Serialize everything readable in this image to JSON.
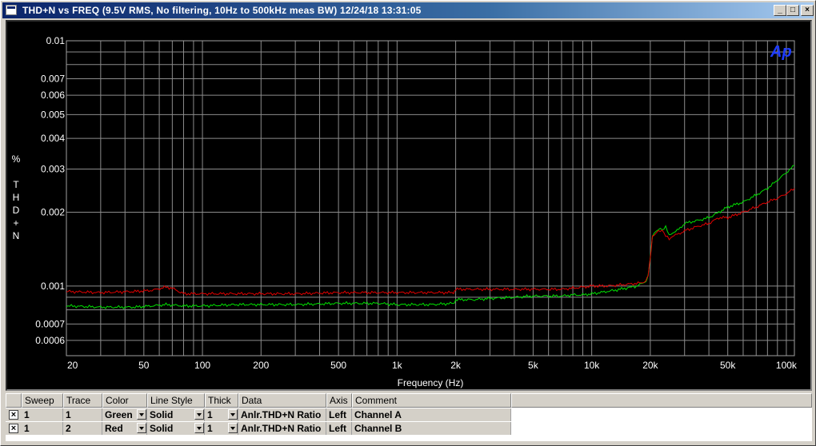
{
  "window": {
    "title": "THD+N vs FREQ (9.5V RMS, No filtering, 10Hz to 500kHz meas BW)  12/24/18 13:31:05",
    "buttons": {
      "minimize": "_",
      "maximize": "□",
      "close": "×"
    }
  },
  "chart_data": {
    "type": "line",
    "xscale": "log",
    "yscale": "log",
    "xlim": [
      20,
      110000
    ],
    "ylim": [
      0.00052,
      0.01
    ],
    "grid": true,
    "xlabel": "Frequency (Hz)",
    "ylabel_lines": [
      "%",
      "",
      "T",
      "H",
      "D",
      "+",
      "N"
    ],
    "x_ticks": [
      {
        "v": 20,
        "label": "20"
      },
      {
        "v": 50,
        "label": "50"
      },
      {
        "v": 100,
        "label": "100"
      },
      {
        "v": 200,
        "label": "200"
      },
      {
        "v": 500,
        "label": "500"
      },
      {
        "v": 1000,
        "label": "1k"
      },
      {
        "v": 2000,
        "label": "2k"
      },
      {
        "v": 5000,
        "label": "5k"
      },
      {
        "v": 10000,
        "label": "10k"
      },
      {
        "v": 20000,
        "label": "20k"
      },
      {
        "v": 50000,
        "label": "50k"
      },
      {
        "v": 100000,
        "label": "100k"
      }
    ],
    "y_ticks": [
      {
        "v": 0.01,
        "label": "0.01"
      },
      {
        "v": 0.007,
        "label": "0.007"
      },
      {
        "v": 0.006,
        "label": "0.006"
      },
      {
        "v": 0.005,
        "label": "0.005"
      },
      {
        "v": 0.004,
        "label": "0.004"
      },
      {
        "v": 0.003,
        "label": "0.003"
      },
      {
        "v": 0.002,
        "label": "0.002"
      },
      {
        "v": 0.001,
        "label": "0.001"
      },
      {
        "v": 0.0007,
        "label": "0.0007"
      },
      {
        "v": 0.0006,
        "label": "0.0006"
      }
    ],
    "logo": "Ap",
    "series": [
      {
        "name": "Channel A",
        "color": "#00e000",
        "x": [
          20,
          30,
          45,
          55,
          65,
          80,
          100,
          150,
          200,
          300,
          500,
          800,
          1000,
          1500,
          1950,
          2000,
          2500,
          3000,
          4000,
          5000,
          6000,
          7000,
          8000,
          9000,
          10000,
          11000,
          12000,
          13000,
          14000,
          15000,
          16000,
          17000,
          18000,
          19000,
          19500,
          20000,
          20500,
          21000,
          22000,
          23000,
          24000,
          25000,
          26000,
          28000,
          30000,
          35000,
          40000,
          45000,
          50000,
          60000,
          70000,
          80000,
          90000,
          100000,
          110000
        ],
        "values": [
          0.00083,
          0.00082,
          0.00082,
          0.00083,
          0.00084,
          0.00083,
          0.00083,
          0.00084,
          0.00084,
          0.00084,
          0.00085,
          0.00085,
          0.00084,
          0.00084,
          0.00085,
          0.00088,
          0.00088,
          0.00089,
          0.0009,
          0.00091,
          0.00091,
          0.00091,
          0.00092,
          0.00092,
          0.00093,
          0.00094,
          0.00095,
          0.00096,
          0.00097,
          0.00098,
          0.00099,
          0.001,
          0.00102,
          0.00105,
          0.0011,
          0.0013,
          0.0016,
          0.00165,
          0.0017,
          0.0017,
          0.00175,
          0.0016,
          0.00165,
          0.0017,
          0.0018,
          0.00185,
          0.0019,
          0.002,
          0.0021,
          0.0022,
          0.00235,
          0.0025,
          0.0027,
          0.0029,
          0.0031
        ]
      },
      {
        "name": "Channel B",
        "color": "#e00000",
        "x": [
          20,
          30,
          45,
          55,
          65,
          70,
          80,
          100,
          150,
          200,
          300,
          500,
          800,
          1000,
          1500,
          1950,
          2000,
          2500,
          3000,
          4000,
          5000,
          6000,
          7000,
          8000,
          9000,
          10000,
          12000,
          14000,
          16000,
          18000,
          19000,
          19500,
          20000,
          20500,
          21000,
          22000,
          23000,
          24000,
          25000,
          26000,
          28000,
          30000,
          35000,
          40000,
          45000,
          50000,
          60000,
          70000,
          80000,
          90000,
          100000,
          110000
        ],
        "values": [
          0.00095,
          0.00094,
          0.00095,
          0.00096,
          0.00099,
          0.00098,
          0.00093,
          0.00093,
          0.00093,
          0.00093,
          0.00093,
          0.00094,
          0.00094,
          0.00094,
          0.00094,
          0.00094,
          0.00097,
          0.00097,
          0.00097,
          0.00097,
          0.00097,
          0.00097,
          0.00097,
          0.00098,
          0.00099,
          0.001,
          0.001,
          0.00101,
          0.00102,
          0.00103,
          0.00105,
          0.0011,
          0.0013,
          0.0016,
          0.00163,
          0.00166,
          0.0017,
          0.0016,
          0.00155,
          0.0016,
          0.00163,
          0.00168,
          0.00175,
          0.0018,
          0.0019,
          0.0019,
          0.002,
          0.0021,
          0.0022,
          0.00228,
          0.00238,
          0.0025
        ]
      }
    ]
  },
  "legend": {
    "headers": [
      "Sweep",
      "Trace",
      "Color",
      "Line Style",
      "Thick",
      "Data",
      "Axis",
      "Comment"
    ],
    "rows": [
      {
        "checked": "×",
        "sweep": "1",
        "trace": "1",
        "color": "Green",
        "line_style": "Solid",
        "thick": "1",
        "data": "Anlr.THD+N Ratio",
        "axis": "Left",
        "comment": "Channel A"
      },
      {
        "checked": "×",
        "sweep": "1",
        "trace": "2",
        "color": "Red",
        "line_style": "Solid",
        "thick": "1",
        "data": "Anlr.THD+N Ratio",
        "axis": "Left",
        "comment": "Channel B"
      }
    ]
  }
}
